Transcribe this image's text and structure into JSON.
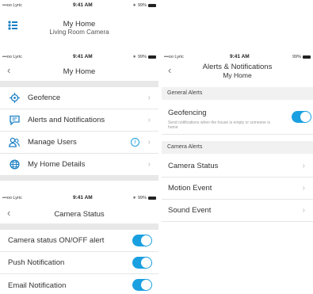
{
  "status_bar": {
    "carrier": "•••oo Lyric",
    "time": "9:41 AM",
    "battery": "99%"
  },
  "home_screen": {
    "title": "My Home",
    "subtitle": "Living Room Camera"
  },
  "my_home_screen": {
    "title": "My Home",
    "items": [
      {
        "label": "Geofence",
        "icon": "location-target-icon"
      },
      {
        "label": "Alerts and Notifications",
        "icon": "chat-bubble-icon"
      },
      {
        "label": "Manage Users",
        "icon": "users-icon"
      },
      {
        "label": "My Home Details",
        "icon": "globe-icon"
      }
    ]
  },
  "camera_status_screen": {
    "title": "Camera Status",
    "toggles": [
      {
        "label": "Camera status ON/OFF alert",
        "on": true
      },
      {
        "label": "Push Notification",
        "on": true
      },
      {
        "label": "Email Notification",
        "on": true
      }
    ]
  },
  "alerts_screen": {
    "title": "Alerts & Notifications",
    "subtitle": "My Home",
    "general_header": "General Alerts",
    "geofencing_label": "Geofencing",
    "geofencing_desc": "Send notifications when the house is empty or someone is home",
    "camera_header": "Camera Alerts",
    "camera_items": [
      "Camera Status",
      "Motion Event",
      "Sound Event"
    ]
  },
  "colors": {
    "accent": "#1aa0e0",
    "icon_blue": "#1a7fc4"
  }
}
